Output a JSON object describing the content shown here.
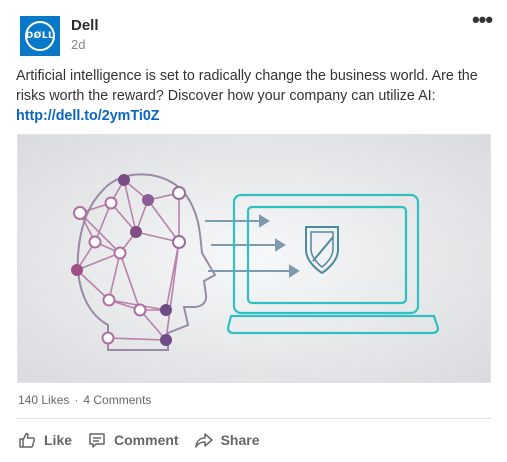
{
  "post": {
    "company": "Dell",
    "logo_text": "DØLL",
    "timestamp": "2d",
    "text": "Artificial intelligence is set to radically change the business world. Are the risks worth the reward? Discover how your company can utilize AI:",
    "link": "http://dell.to/2ymTi0Z"
  },
  "menu_icon": "more-icon",
  "stats": {
    "likes": "140 Likes",
    "separator": "·",
    "comments": "4 Comments"
  },
  "actions": {
    "like": "Like",
    "comment": "Comment",
    "share": "Share"
  },
  "colors": {
    "brand": "#0a78c8",
    "link": "#0a66c2",
    "teal": "#2fc1c1",
    "purple": "#7a4e84"
  }
}
